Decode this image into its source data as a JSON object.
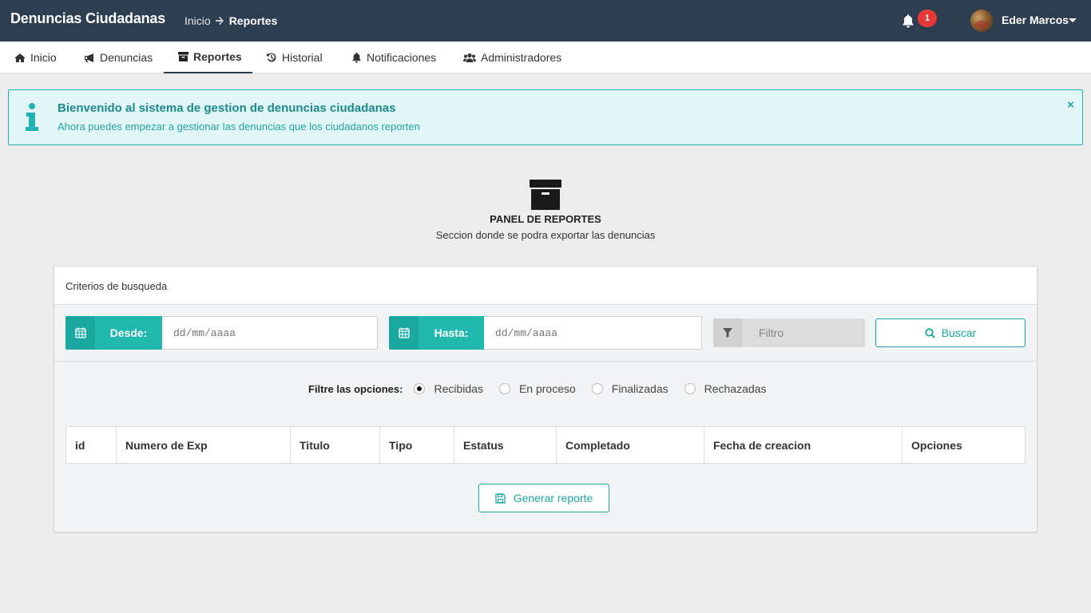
{
  "app": {
    "brand": "Denuncias Ciudadanas"
  },
  "breadcrumb": {
    "home": "Inicio",
    "current": "Reportes"
  },
  "header": {
    "notif_count": "1",
    "user_name": "Eder Marcos"
  },
  "nav": {
    "items": [
      {
        "label": "Inicio",
        "icon": "home-icon"
      },
      {
        "label": "Denuncias",
        "icon": "bullhorn-icon"
      },
      {
        "label": "Reportes",
        "icon": "archive-icon",
        "active": true
      },
      {
        "label": "Historial",
        "icon": "history-icon"
      },
      {
        "label": "Notificaciones",
        "icon": "bell-icon"
      },
      {
        "label": "Administradores",
        "icon": "users-icon"
      }
    ]
  },
  "alert": {
    "title": "Bienvenido al sistema de gestion de denuncias ciudadanas",
    "text": "Ahora puedes empezar a gestionar las denuncias que los ciudadanos reporten",
    "close": "×"
  },
  "panel": {
    "title": "PANEL DE REPORTES",
    "subtitle": "Seccion donde se podra exportar las denuncias"
  },
  "search": {
    "header": "Criterios de busqueda",
    "desde_label": "Desde:",
    "hasta_label": "Hasta:",
    "date_placeholder": "dd/mm/aaaa",
    "filtro_label": "Filtro",
    "buscar_label": "Buscar"
  },
  "filters": {
    "label": "Filtre las opciones:",
    "options": [
      "Recibidas",
      "En proceso",
      "Finalizadas",
      "Rechazadas"
    ],
    "selected": "Recibidas"
  },
  "table": {
    "columns": [
      "id",
      "Numero de Exp",
      "Titulo",
      "Tipo",
      "Estatus",
      "Completado",
      "Fecha de creacion",
      "Opciones"
    ]
  },
  "actions": {
    "generate_label": "Generar reporte"
  },
  "colors": {
    "topbar": "#2c3e50",
    "accent": "#1aa8a0",
    "alert_bg": "#e0f6f7",
    "badge": "#e53935"
  }
}
